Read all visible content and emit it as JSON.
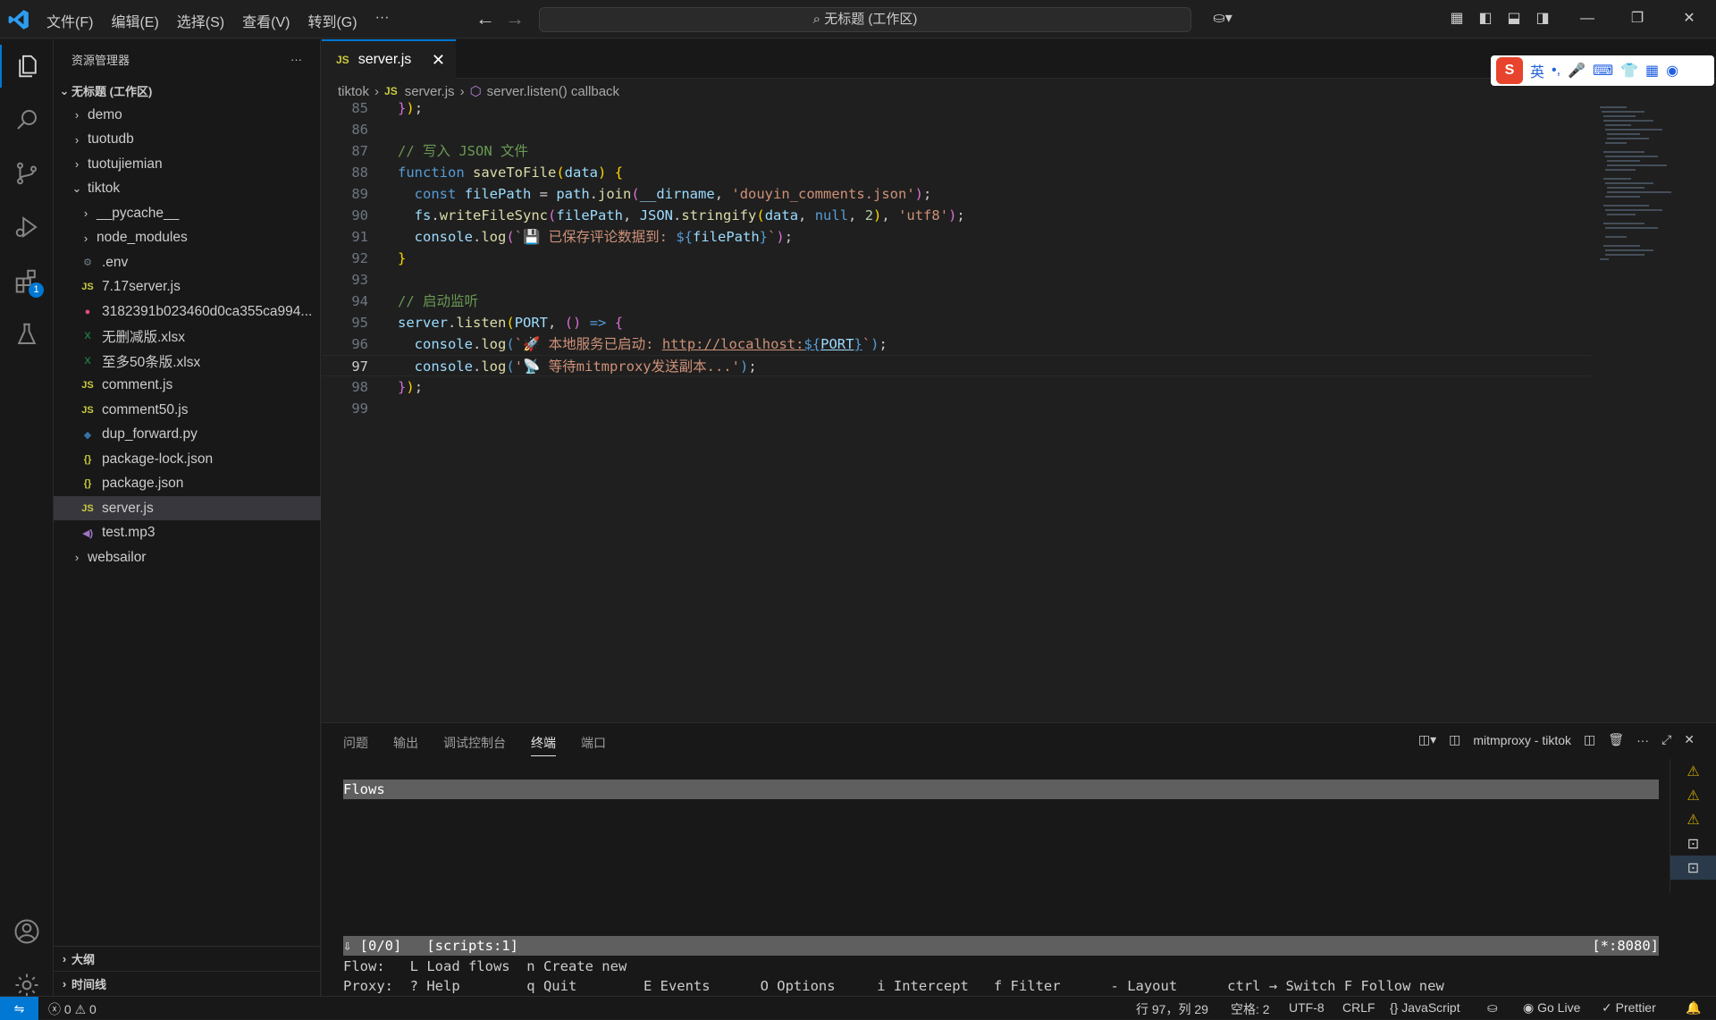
{
  "menu": [
    "文件(F)",
    "编辑(E)",
    "选择(S)",
    "查看(V)",
    "转到(G)",
    "···"
  ],
  "command_center": "无标题 (工作区)",
  "sidebar": {
    "title": "资源管理器",
    "more": "···",
    "workspace": "无标题 (工作区)",
    "items": [
      {
        "label": "demo",
        "type": "folder"
      },
      {
        "label": "tuotudb",
        "type": "folder"
      },
      {
        "label": "tuotujiemian",
        "type": "folder"
      },
      {
        "label": "tiktok",
        "type": "folder-open"
      },
      {
        "label": "__pycache__",
        "type": "folder"
      },
      {
        "label": "node_modules",
        "type": "folder"
      },
      {
        "label": ".env",
        "type": "gear"
      },
      {
        "label": "7.17server.js",
        "type": "js"
      },
      {
        "label": "3182391b023460d0ca355ca994...",
        "type": "media"
      },
      {
        "label": "无删减版.xlsx",
        "type": "xlsx"
      },
      {
        "label": "至多50条版.xlsx",
        "type": "xlsx"
      },
      {
        "label": "comment.js",
        "type": "js"
      },
      {
        "label": "comment50.js",
        "type": "js"
      },
      {
        "label": "dup_forward.py",
        "type": "py"
      },
      {
        "label": "package-lock.json",
        "type": "json"
      },
      {
        "label": "package.json",
        "type": "json"
      },
      {
        "label": "server.js",
        "type": "js"
      },
      {
        "label": "test.mp3",
        "type": "audio"
      },
      {
        "label": "websailor",
        "type": "folder"
      }
    ],
    "outline": "大纲",
    "timeline": "时间线"
  },
  "editor": {
    "tab": "server.js",
    "js_badge": "JS",
    "breadcrumb": [
      "tiktok",
      "server.js",
      "server.listen() callback"
    ],
    "line_numbers": [
      "85",
      "86",
      "87",
      "88",
      "89",
      "90",
      "91",
      "92",
      "93",
      "94",
      "95",
      "96",
      "97",
      "98",
      "99"
    ]
  },
  "ime": {
    "lang": "英"
  },
  "panel": {
    "tabs": [
      "问题",
      "输出",
      "调试控制台",
      "终端",
      "端口"
    ],
    "terminal_name": "mitmproxy - tiktok",
    "flows": "Flows",
    "status_left": "⇩ [0/0]   [scripts:1]",
    "status_right": "[*:8080]",
    "line1": "Flow:   L Load flows  n Create new",
    "line2": "Proxy:  ? Help        q Quit        E Events      O Options     i Intercept   f Filter      - Layout      ctrl → Switch F Follow new"
  },
  "status": {
    "errors": "0",
    "warnings": "0",
    "position": "行 97，列 29",
    "spaces": "空格: 2",
    "encoding": "UTF-8",
    "eol": "CRLF",
    "language": "{} JavaScript",
    "golive": "Go Live",
    "prettier": "Prettier"
  }
}
